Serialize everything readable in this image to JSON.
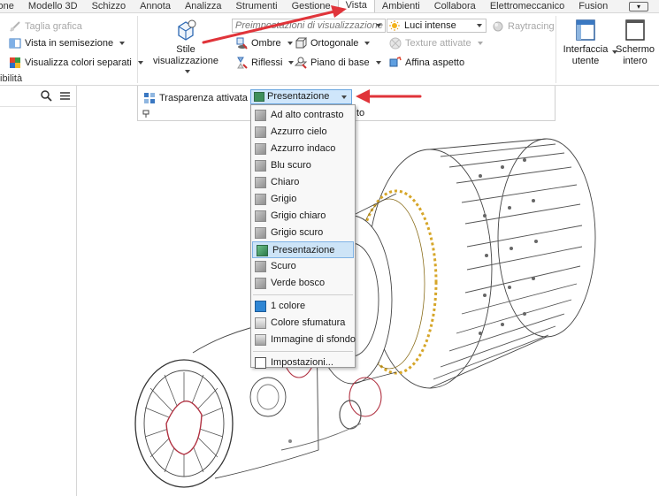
{
  "tabs": [
    "zazione",
    "Modello 3D",
    "Schizzo",
    "Annota",
    "Analizza",
    "Strumenti",
    "Gestione",
    "Vista",
    "Ambienti",
    "Collabora",
    "Elettromeccanico",
    "Fusion"
  ],
  "active_tab": "Vista",
  "ribbon": {
    "taglia_grafica": "Taglia grafica",
    "vista_semisezione": "Vista in semisezione",
    "visualizza_colori": "Visualizza colori separati",
    "visibilita_section": "ibilità",
    "stile_visualizzazione": "Stile visualizzazione",
    "preimpostazioni": "Preimpostazioni di visualizzazione",
    "ombre": "Ombre",
    "riflessi": "Riflessi",
    "ortogonale": "Ortogonale",
    "piano_di_base": "Piano di base",
    "luci_intense": "Luci intense",
    "texture_attivate": "Texture attivate",
    "affina_aspetto": "Affina aspetto",
    "raytracing": "Raytracing",
    "interfaccia_utente": "Interfaccia utente",
    "schermo_intero": "Schermo intero",
    "trasparenza_attivata": "Trasparenza attivata",
    "presentazione_combo": "Presentazione",
    "aspetto_label_tail": "to"
  },
  "menu": {
    "items": [
      "Ad alto contrasto",
      "Azzurro cielo",
      "Azzurro indaco",
      "Blu scuro",
      "Chiaro",
      "Grigio",
      "Grigio chiaro",
      "Grigio scuro",
      "Presentazione",
      "Scuro",
      "Verde bosco"
    ],
    "selected": "Presentazione",
    "extra_items": [
      "1 colore",
      "Colore sfumatura",
      "Immagine di sfondo"
    ],
    "settings": "Impostazioni..."
  },
  "colors": {
    "annotation_arrow": "#e0343a",
    "selected_bg": "#cde4f7",
    "selected_border": "#7fb3e5"
  }
}
